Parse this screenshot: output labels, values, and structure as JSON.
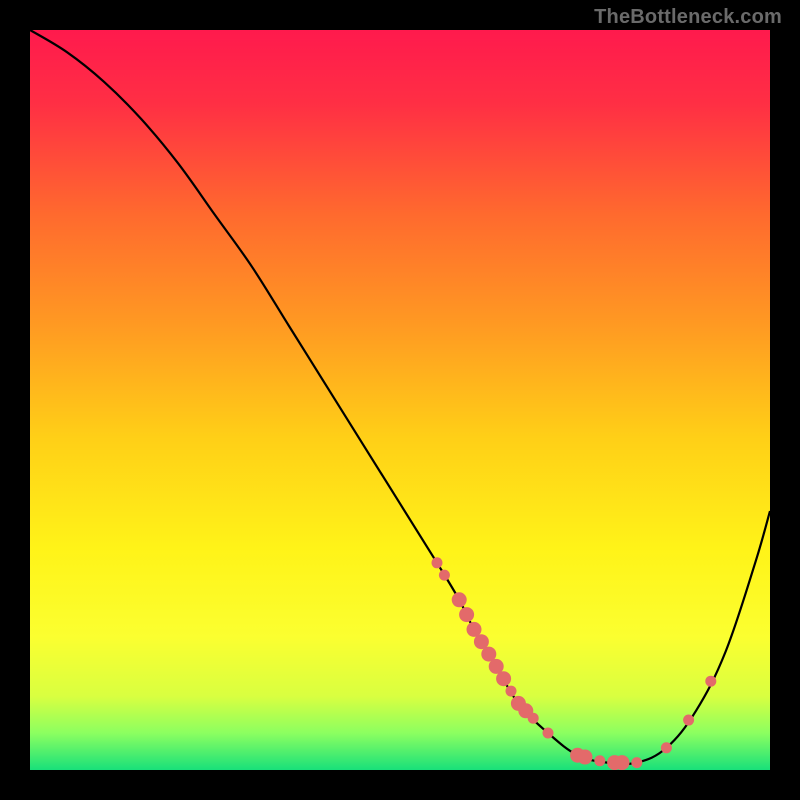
{
  "watermark": "TheBottleneck.com",
  "gradient": {
    "stops": [
      {
        "offset": 0.0,
        "color": "#ff1a4d"
      },
      {
        "offset": 0.1,
        "color": "#ff2f44"
      },
      {
        "offset": 0.25,
        "color": "#ff6a2e"
      },
      {
        "offset": 0.4,
        "color": "#ff9a22"
      },
      {
        "offset": 0.55,
        "color": "#ffcf17"
      },
      {
        "offset": 0.7,
        "color": "#fff318"
      },
      {
        "offset": 0.82,
        "color": "#fbff30"
      },
      {
        "offset": 0.9,
        "color": "#d9ff40"
      },
      {
        "offset": 0.95,
        "color": "#8cff60"
      },
      {
        "offset": 1.0,
        "color": "#18e07a"
      }
    ]
  },
  "chart_data": {
    "type": "line",
    "title": "",
    "xlabel": "",
    "ylabel": "",
    "xlim": [
      0,
      100
    ],
    "ylim": [
      0,
      100
    ],
    "series": [
      {
        "name": "curve",
        "x": [
          0,
          5,
          10,
          15,
          20,
          25,
          30,
          35,
          40,
          45,
          50,
          55,
          58,
          60,
          63,
          66,
          70,
          74,
          78,
          82,
          86,
          90,
          94,
          98,
          100
        ],
        "y": [
          100,
          97,
          93,
          88,
          82,
          75,
          68,
          60,
          52,
          44,
          36,
          28,
          23,
          19,
          14,
          9,
          5,
          2,
          1,
          1,
          3,
          8,
          16,
          28,
          35
        ]
      }
    ],
    "markers": {
      "color": "#e36a6a",
      "size_small": 5.5,
      "size_large": 7.5,
      "points": [
        {
          "x": 55,
          "size": "small"
        },
        {
          "x": 56,
          "size": "small"
        },
        {
          "x": 58,
          "size": "large"
        },
        {
          "x": 59,
          "size": "large"
        },
        {
          "x": 60,
          "size": "large"
        },
        {
          "x": 61,
          "size": "large"
        },
        {
          "x": 62,
          "size": "large"
        },
        {
          "x": 63,
          "size": "large"
        },
        {
          "x": 64,
          "size": "large"
        },
        {
          "x": 65,
          "size": "small"
        },
        {
          "x": 66,
          "size": "large"
        },
        {
          "x": 67,
          "size": "large"
        },
        {
          "x": 68,
          "size": "small"
        },
        {
          "x": 70,
          "size": "small"
        },
        {
          "x": 74,
          "size": "large"
        },
        {
          "x": 75,
          "size": "large"
        },
        {
          "x": 77,
          "size": "small"
        },
        {
          "x": 79,
          "size": "large"
        },
        {
          "x": 80,
          "size": "large"
        },
        {
          "x": 82,
          "size": "small"
        },
        {
          "x": 86,
          "size": "small"
        },
        {
          "x": 89,
          "size": "small"
        },
        {
          "x": 92,
          "size": "small"
        }
      ]
    }
  }
}
